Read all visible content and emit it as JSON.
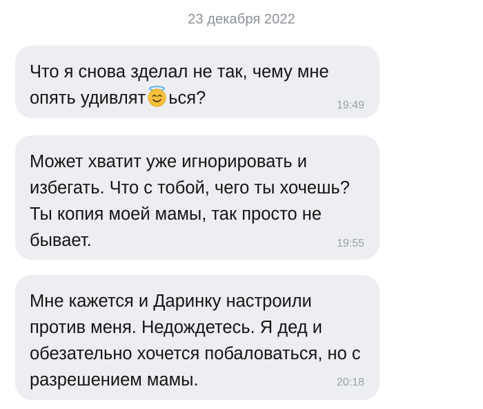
{
  "conversation": {
    "date_separator": "23 декабря 2022",
    "messages": [
      {
        "text_before_emoji": "Что я снова зделал не так, чему мне опять удивлят",
        "emoji": "smiling-face-with-halo-icon",
        "text_after_emoji": "ься?",
        "time": "19:49"
      },
      {
        "text": "Может хватит уже игнорировать и избегать. Что с тобой, чего ты хочешь? Ты копия моей мамы, так просто не бывает.",
        "time": "19:55"
      },
      {
        "text": "Мне кажется и Даринку настроили против меня. Недождетесь. Я дед и обезательно хочется побаловаться, но с разрешением мамы.",
        "time": "20:18"
      }
    ]
  },
  "colors": {
    "bubble_background": "#eceef1",
    "message_text": "#141414",
    "timestamp": "#9aa0a7",
    "date_separator": "#8a8f96",
    "emoji_face": "#f7c23b",
    "emoji_halo": "#6fb8ee"
  }
}
